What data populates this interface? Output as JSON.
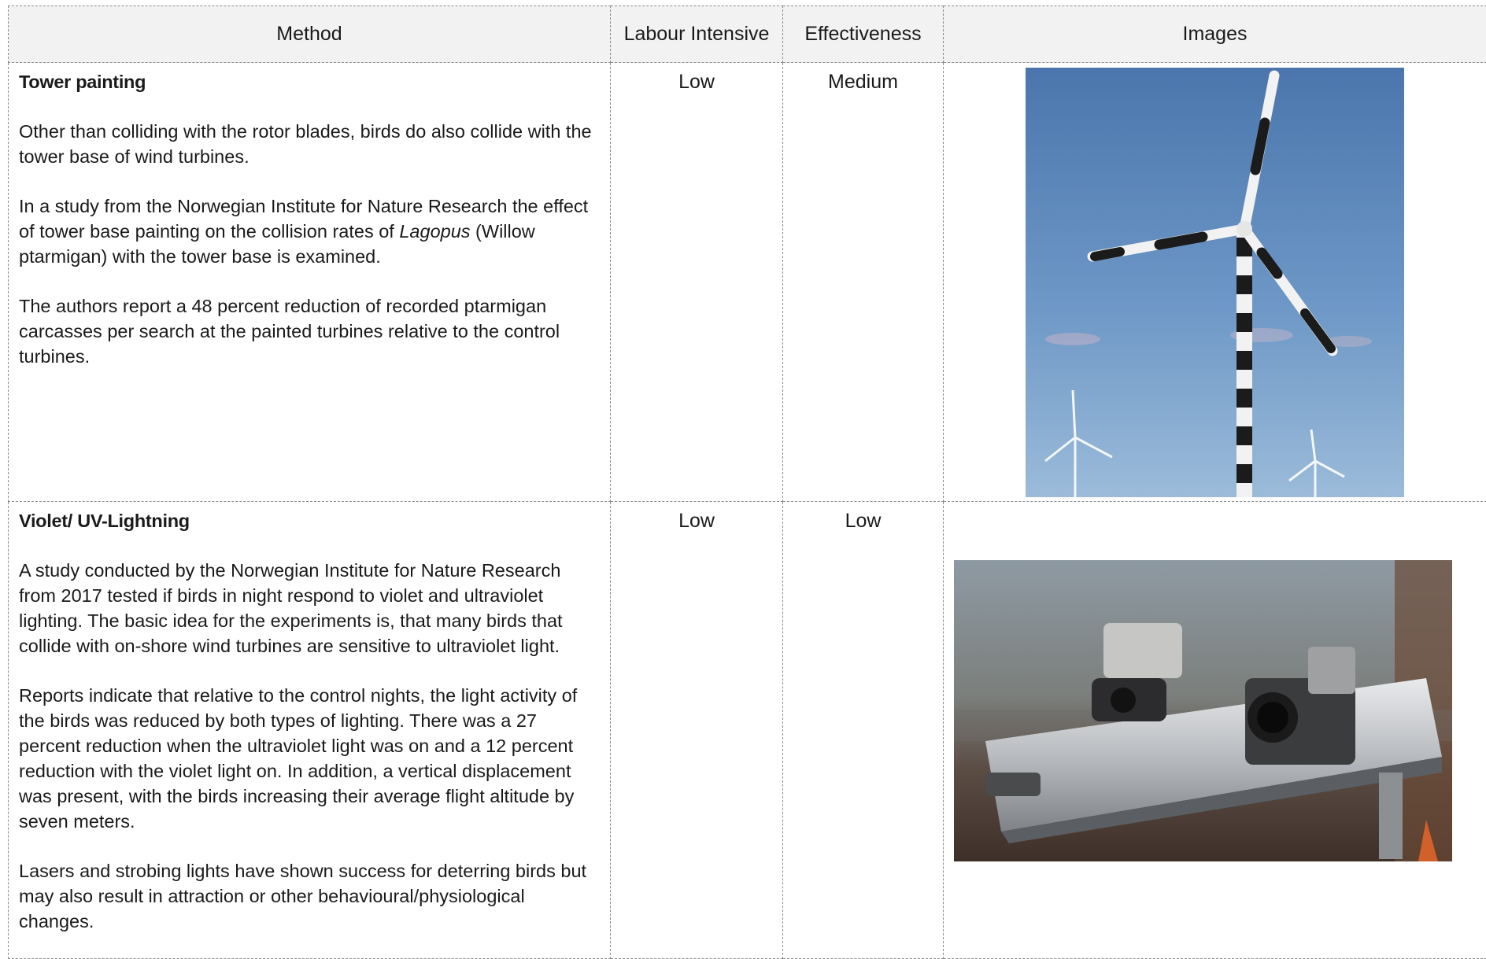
{
  "table": {
    "headers": [
      "Method",
      "Labour Intensive",
      "Effectiveness",
      "Images"
    ],
    "rows": [
      {
        "title": "Tower painting",
        "paragraphs": [
          "Other than colliding with the rotor blades, birds do also collide with the tower base of wind turbines.",
          "In a study from the Norwegian Institute for Nature Research the effect of tower base painting on the collision rates of Lagopus (Willow ptarmigan) with the tower base is examined.",
          "The authors report a 48 percent reduction of recorded ptarmigan carcasses per search at the painted turbines relative to the control turbines."
        ],
        "labour_intensive": "Low",
        "effectiveness": "Medium"
      },
      {
        "title": "Violet/ UV-Lightning",
        "paragraphs": [
          "A study conducted by the Norwegian Institute for Nature Research from 2017 tested if birds in night respond to violet and ultraviolet lighting. The basic idea for the experiments is, that many birds that collide with on-shore wind turbines are sensitive to ultraviolet light.",
          "Reports indicate that relative to the control nights, the light activity of the birds was reduced by both types of lighting. There was a 27 percent reduction when the ultraviolet light was on and a 12 percent reduction with the violet light on. In addition, a vertical displacement was present, with the birds increasing their average flight altitude by seven meters.",
          "Lasers and strobing lights have shown success for deterring birds but may also result in attraction or other behavioural/physiological changes."
        ],
        "labour_intensive": "Low",
        "effectiveness": "Low"
      }
    ]
  },
  "row1_paragraph2_parts": {
    "before": "In a study from the Norwegian Institute for Nature Research the effect of tower base painting on the collision rates of ",
    "italic": "Lagopus",
    "after": " (Willow ptarmigan) with the tower base is examined."
  },
  "colors": {
    "header_bg": "#f2f2f2",
    "border": "#8a8a8a",
    "sky": "#4f7fb4"
  }
}
